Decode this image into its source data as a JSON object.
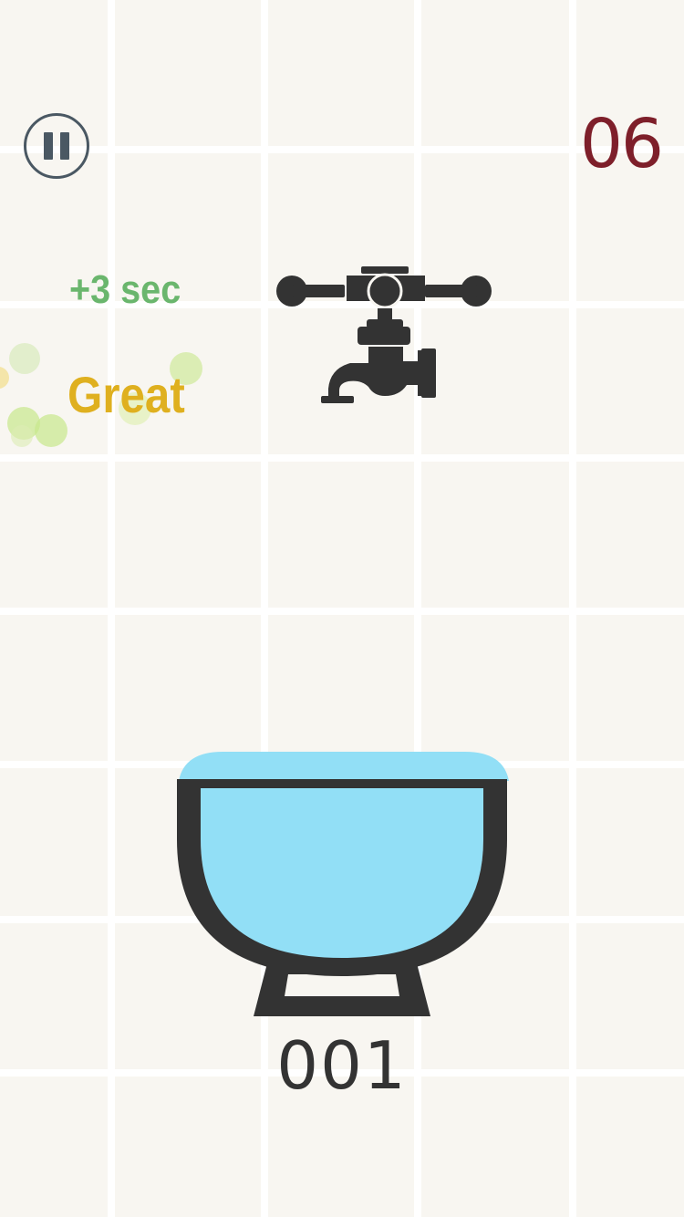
{
  "hud": {
    "timer": "06",
    "pause_icon": "pause-icon"
  },
  "feedback": {
    "bonus": "+3 sec",
    "rating": "Great"
  },
  "score": "001",
  "colors": {
    "background": "#f8f6f1",
    "grid_line": "#ffffff",
    "timer": "#7e1f2a",
    "bonus_text": "#6ab66d",
    "rating_text": "#dfb01f",
    "water": "#92dff6",
    "bowl_outline": "#333333",
    "faucet": "#333333"
  },
  "icons": {
    "faucet": "faucet-icon",
    "bowl": "water-bowl"
  }
}
